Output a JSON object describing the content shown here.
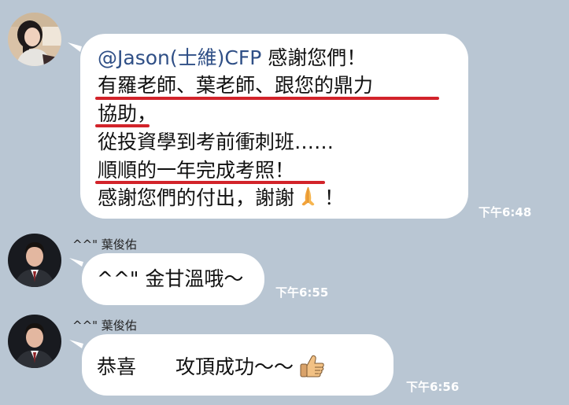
{
  "messages": [
    {
      "mention": "@Jason(士維)CFP",
      "mention_suffix": " 感謝您們！",
      "lines": [
        "有羅老師、葉老師、跟您的鼎力",
        "協助，",
        "從投資學到考前衝刺班……",
        "順順的一年完成考照！",
        "感謝您們的付出，謝謝"
      ],
      "end_text": "！",
      "emoji_icon": "folded-hands-icon",
      "time": "下午6:48"
    },
    {
      "sender": "^^\" 葉俊佑",
      "text": "^^\" 金甘溫哦～",
      "time": "下午6:55"
    },
    {
      "sender": "^^\" 葉俊佑",
      "text": "恭喜　　攻頂成功～～",
      "emoji_icon": "thumbs-up-icon",
      "time": "下午6:56"
    }
  ],
  "colors": {
    "chat_background": "#b9c6d3",
    "bubble": "#ffffff",
    "mention": "#2f4f86",
    "underline": "#d2232a",
    "time_text": "#ffffff"
  }
}
